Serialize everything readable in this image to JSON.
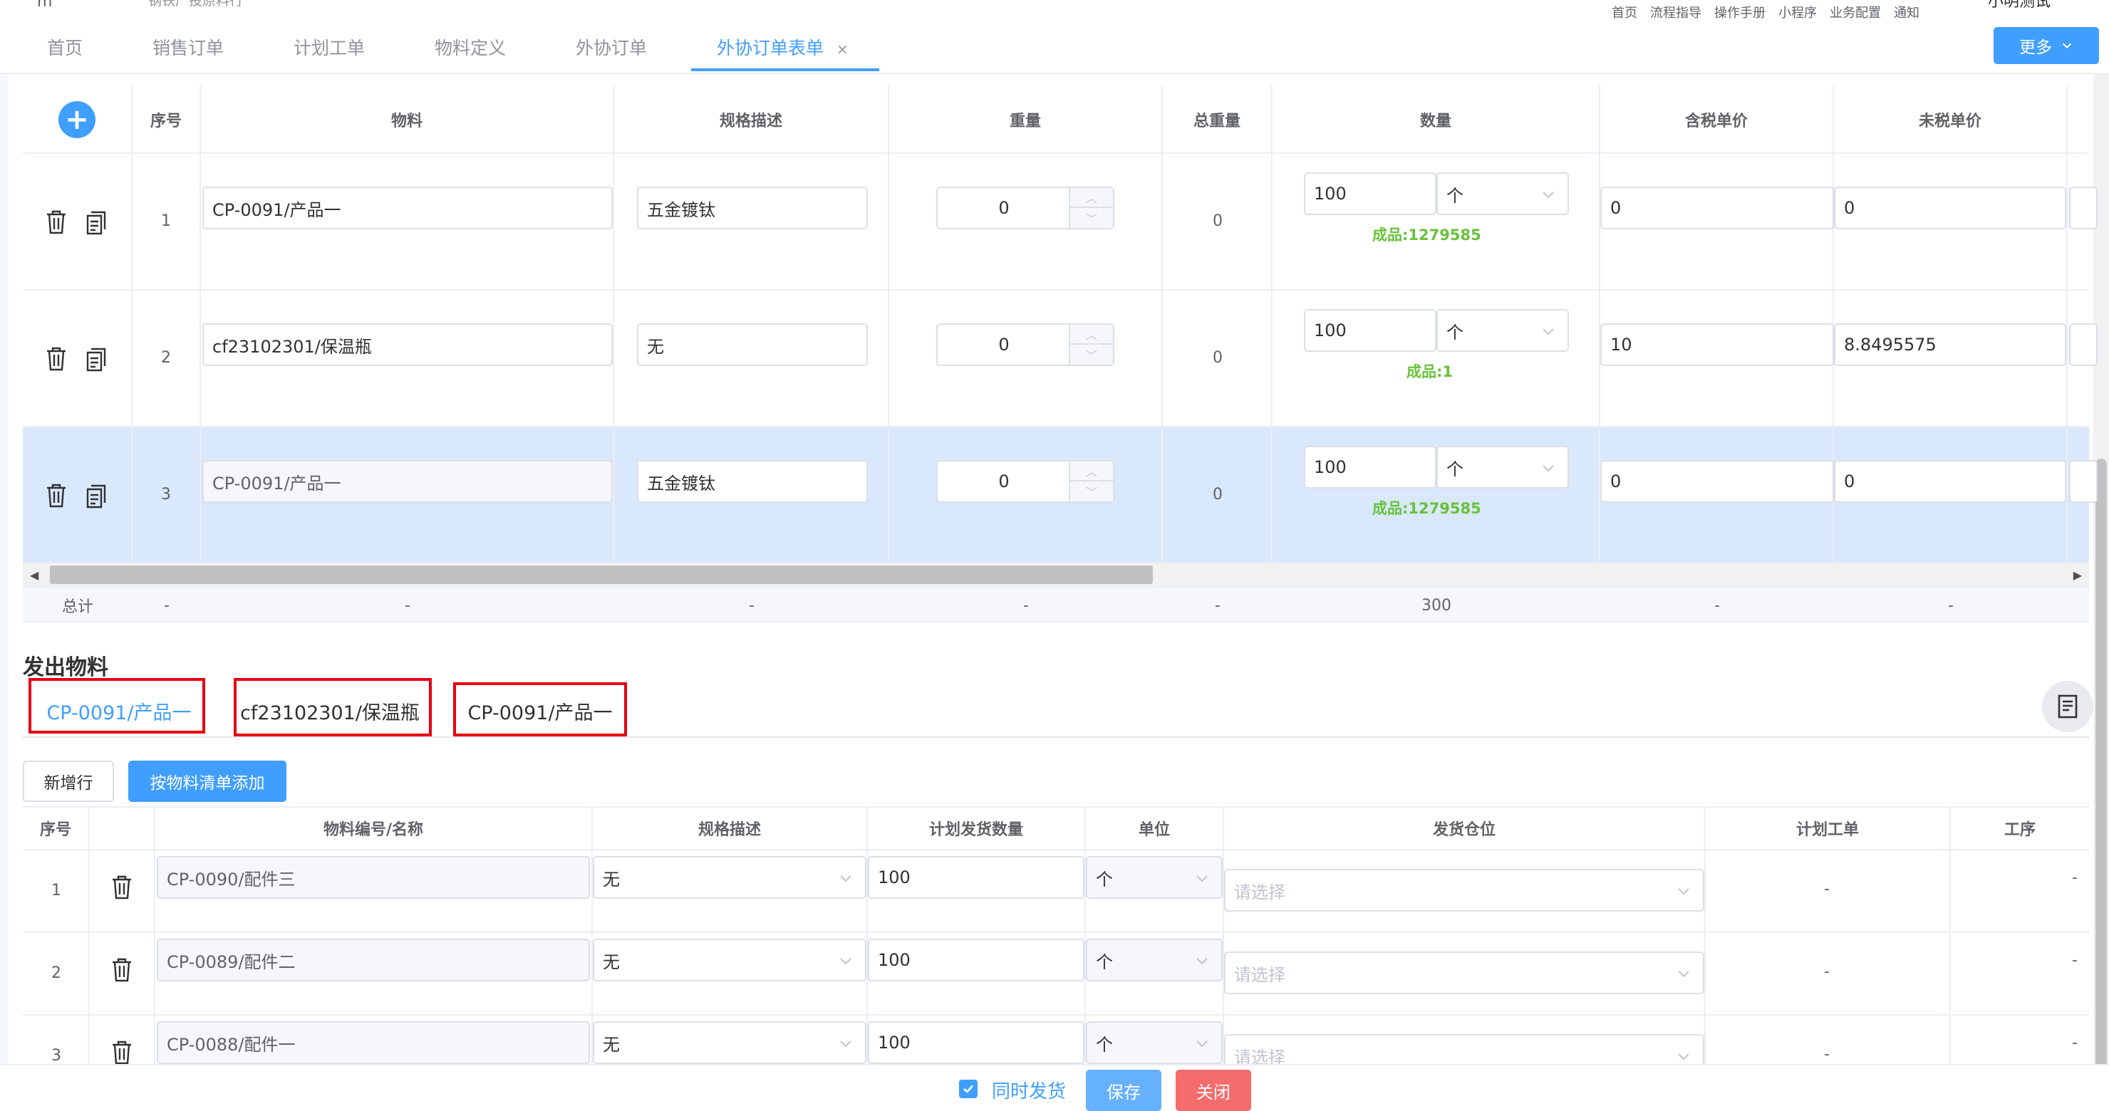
{
  "header": {
    "partial_left_text": "m",
    "partial_subtitle": "钢铁厂投原料行",
    "quick_links": [
      "首页",
      "流程指导",
      "操作手册",
      "小程序",
      "业务配置",
      "通知"
    ],
    "user_partial": "小明测试"
  },
  "tabs": [
    {
      "label": "首页"
    },
    {
      "label": "销售订单"
    },
    {
      "label": "计划工单"
    },
    {
      "label": "物料定义"
    },
    {
      "label": "外协订单"
    },
    {
      "label": "外协订单表单",
      "active": true,
      "closable": true
    }
  ],
  "tab_close_glyph": "×",
  "more_button": {
    "label": "更多"
  },
  "upper_table": {
    "add_glyph": "+",
    "columns": [
      "序号",
      "物料",
      "规格描述",
      "重量",
      "总重量",
      "数量",
      "含税单价",
      "未税单价"
    ],
    "rows": [
      {
        "index": "1",
        "material": "CP-0091/产品一",
        "spec": "五金镀钛",
        "weight": "0",
        "total_weight": "0",
        "qty": "100",
        "unit": "个",
        "stock": "成品:1279585",
        "price_tax": "0",
        "price_notax": "0",
        "material_disabled": false
      },
      {
        "index": "2",
        "material": "cf23102301/保温瓶",
        "spec": "无",
        "weight": "0",
        "total_weight": "0",
        "qty": "100",
        "unit": "个",
        "stock": "成品:1",
        "price_tax": "10",
        "price_notax": "8.8495575",
        "material_disabled": false
      },
      {
        "index": "3",
        "material": "CP-0091/产品一",
        "spec": "五金镀钛",
        "weight": "0",
        "total_weight": "0",
        "qty": "100",
        "unit": "个",
        "stock": "成品:1279585",
        "price_tax": "0",
        "price_notax": "0",
        "material_disabled": true,
        "selected": true
      }
    ],
    "summary": [
      "总计",
      "-",
      "-",
      "-",
      "-",
      "-",
      "300",
      "-",
      "-"
    ]
  },
  "issue_section": {
    "title": "发出物料",
    "subtabs": [
      {
        "label": "CP-0091/产品一",
        "active": true
      },
      {
        "label": "cf23102301/保温瓶"
      },
      {
        "label": "CP-0091/产品一"
      }
    ],
    "highlight_color": "#e60012",
    "add_row_label": "新增行",
    "add_from_bom_label": "按物料清单添加"
  },
  "lower_table": {
    "columns": [
      "序号",
      "",
      "物料编号/名称",
      "规格描述",
      "计划发货数量",
      "单位",
      "发货仓位",
      "计划工单",
      "工序"
    ],
    "rows": [
      {
        "index": "1",
        "material": "CP-0090/配件三",
        "spec": "无",
        "plan_qty": "100",
        "unit": "个",
        "warehouse_placeholder": "请选择",
        "work_order": "-",
        "process": "-"
      },
      {
        "index": "2",
        "material": "CP-0089/配件二",
        "spec": "无",
        "plan_qty": "100",
        "unit": "个",
        "warehouse_placeholder": "请选择",
        "work_order": "-",
        "process": "-"
      },
      {
        "index": "3",
        "material": "CP-0088/配件一",
        "spec": "无",
        "plan_qty": "100",
        "unit": "个",
        "warehouse_placeholder": "请选择",
        "work_order": "-",
        "process": "-"
      }
    ]
  },
  "footer": {
    "ship_together_label": "同时发货",
    "ship_together_checked": true,
    "save_label": "保存",
    "close_label": "关闭"
  },
  "colors": {
    "primary": "#409eff",
    "success": "#67c23a",
    "danger": "#f56c6c",
    "row_selected": "#d9e8fb",
    "highlight_box": "#e60012"
  }
}
